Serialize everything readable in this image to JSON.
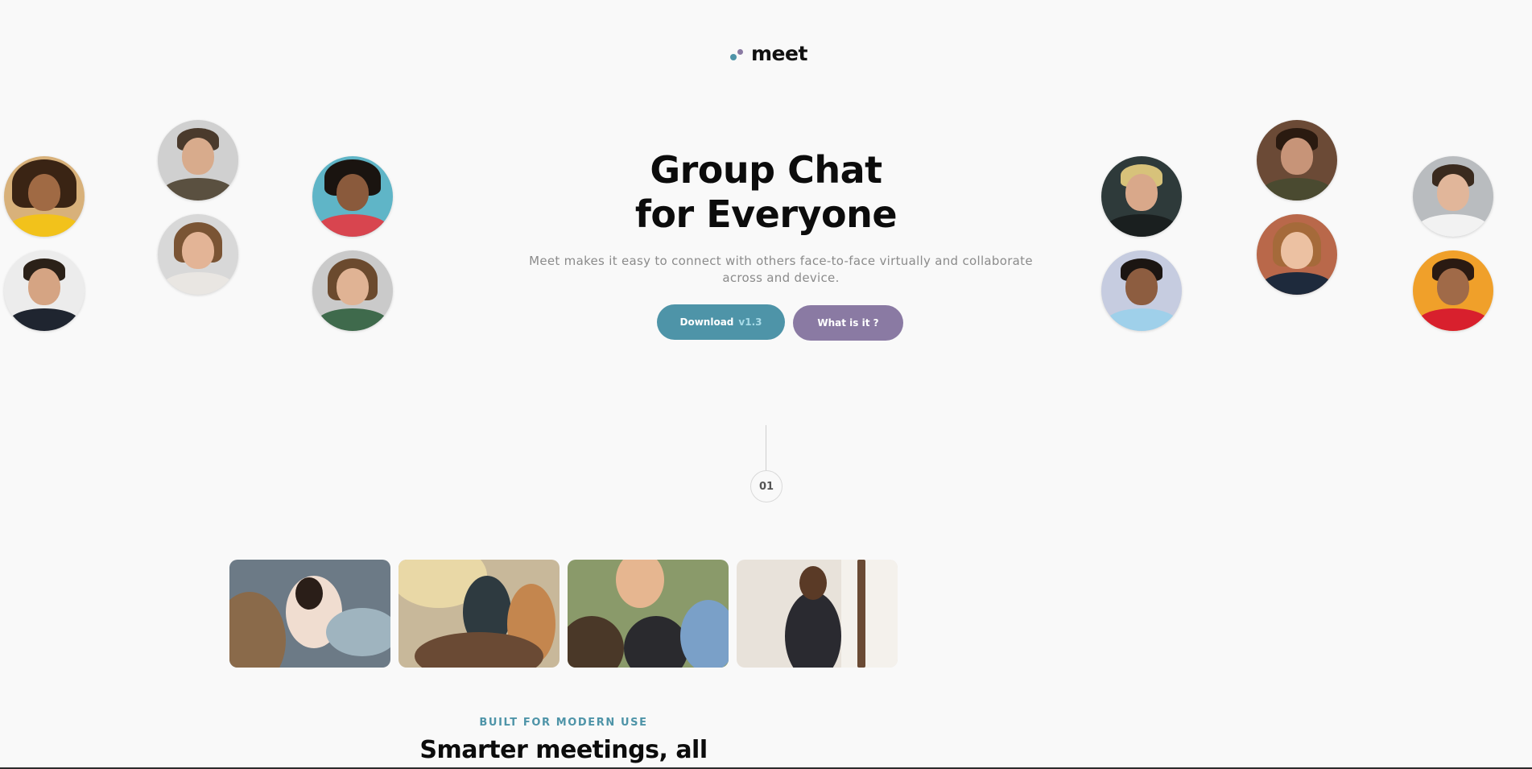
{
  "brand": {
    "name": "meet",
    "logo_icon": "two-dots-logo-icon",
    "colors": {
      "primary": "#4e94a8",
      "secondary": "#8a7aa3"
    }
  },
  "hero": {
    "title_line1": "Group Chat",
    "title_line2": "for Everyone",
    "subtitle": "Meet makes it easy to connect with others face-to-face virtually and collaborate across and device.",
    "download_label": "Download",
    "download_version": "v1.3",
    "what_label": "What is it ?"
  },
  "avatars_left": [
    {
      "name": "woman-curly-hair-yellow-top",
      "bg": "#d8b17a"
    },
    {
      "name": "man-suit-smiling",
      "bg": "#e8e8e8"
    },
    {
      "name": "man-beard-khaki-shirt",
      "bg": "#cfcfcf"
    },
    {
      "name": "woman-laughing",
      "bg": "#d6d6d6"
    },
    {
      "name": "man-afro-blue-bg",
      "bg": "#5fb5c7"
    },
    {
      "name": "woman-glasses-green",
      "bg": "#c9c9c9"
    }
  ],
  "avatars_right": [
    {
      "name": "man-blond-hair-dark-bg",
      "bg": "#2e3a3a"
    },
    {
      "name": "man-curly-light-blue-shirt",
      "bg": "#c6cce0"
    },
    {
      "name": "woman-brown-bg",
      "bg": "#6b4a36"
    },
    {
      "name": "woman-brick-wall",
      "bg": "#b9684a"
    },
    {
      "name": "man-glasses-grey-bg",
      "bg": "#b9bcbf"
    },
    {
      "name": "woman-red-top-orange-bg",
      "bg": "#f0a02a"
    }
  ],
  "step": {
    "number": "01"
  },
  "photos": [
    {
      "name": "woman-laptop-office"
    },
    {
      "name": "people-cafe-meeting"
    },
    {
      "name": "team-high-five"
    },
    {
      "name": "man-thumbs-up-coffee"
    }
  ],
  "section": {
    "eyebrow": "BUILT FOR MODERN USE",
    "title": "Smarter meetings, all"
  }
}
